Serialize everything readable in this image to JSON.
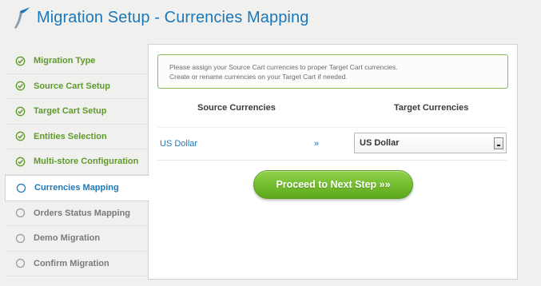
{
  "header": {
    "title": "Migration Setup - Currencies Mapping"
  },
  "colors": {
    "brand_blue": "#1c78b8",
    "done_green": "#5f9a2c",
    "pending_gray": "#7a7a7a",
    "button_green": "#74bd2e"
  },
  "sidebar": {
    "steps": [
      {
        "label": "Migration Type",
        "status": "done",
        "icon": "check-circle-icon"
      },
      {
        "label": "Source Cart Setup",
        "status": "done",
        "icon": "check-circle-icon"
      },
      {
        "label": "Target Cart Setup",
        "status": "done",
        "icon": "check-circle-icon"
      },
      {
        "label": "Entities Selection",
        "status": "done",
        "icon": "check-circle-icon"
      },
      {
        "label": "Multi-store Configuration",
        "status": "done",
        "icon": "check-circle-icon"
      },
      {
        "label": "Currencies Mapping",
        "status": "active",
        "icon": "circle-icon"
      },
      {
        "label": "Orders Status Mapping",
        "status": "pending",
        "icon": "circle-icon"
      },
      {
        "label": "Demo Migration",
        "status": "pending",
        "icon": "circle-icon"
      },
      {
        "label": "Confirm Migration",
        "status": "pending",
        "icon": "circle-icon"
      }
    ]
  },
  "notice": {
    "line1": "Please assign your Source Cart currencies to proper Target Cart currencies.",
    "line2": "Create or rename currencies on your Target Cart if needed."
  },
  "mapping": {
    "source_header": "Source Currencies",
    "target_header": "Target Currencies",
    "rows": [
      {
        "source": "US Dollar",
        "arrow": "»",
        "target": "US Dollar"
      }
    ]
  },
  "actions": {
    "proceed_label": "Proceed to Next Step »»"
  }
}
